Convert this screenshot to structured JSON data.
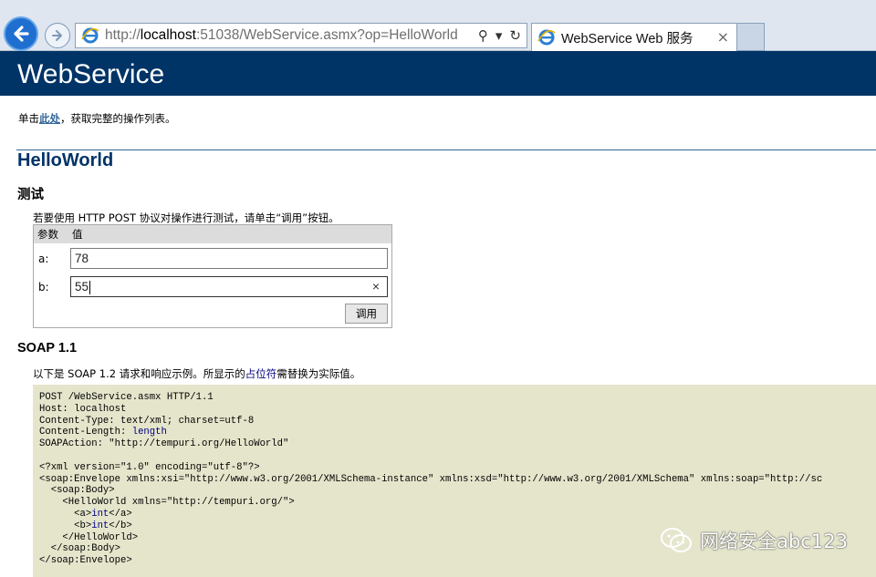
{
  "browser": {
    "url_prefix": "http://",
    "url_host": "localhost",
    "url_rest": ":51038/WebService.asmx?op=HelloWorld",
    "search_glyph": "⚲",
    "dropdown_glyph": "▾",
    "refresh_glyph": "↻",
    "tab_title": "WebService Web 服务",
    "tab_close": "×"
  },
  "header": {
    "title": "WebService"
  },
  "intro": {
    "before": "单击",
    "link": "此处",
    "after": "，获取完整的操作列表。"
  },
  "operation": {
    "name": "HelloWorld"
  },
  "test": {
    "heading": "测试",
    "note": "若要使用 HTTP POST 协议对操作进行测试，请单击“调用”按钮。",
    "col_param": "参数",
    "col_value": "值",
    "params": [
      {
        "label": "a:",
        "value": "78"
      },
      {
        "label": "b:",
        "value": "55"
      }
    ],
    "clear_glyph": "×",
    "invoke_label": "调用"
  },
  "soap": {
    "heading": "SOAP 1.1",
    "note_before": "以下是 SOAP 1.2 请求和响应示例。所显示的",
    "note_link": "占位符",
    "note_after": "需替换为实际值。",
    "lines": [
      "POST /WebService.asmx HTTP/1.1",
      "Host: localhost",
      "Content-Type: text/xml; charset=utf-8",
      "Content-Length: ",
      "SOAPAction: \"http://tempuri.org/HelloWorld\"",
      "",
      "<?xml version=\"1.0\" encoding=\"utf-8\"?>",
      "<soap:Envelope xmlns:xsi=\"http://www.w3.org/2001/XMLSchema-instance\" xmlns:xsd=\"http://www.w3.org/2001/XMLSchema\" xmlns:soap=\"http://sc",
      "  <soap:Body>",
      "    <HelloWorld xmlns=\"http://tempuri.org/\">",
      "      <a>",
      "      <b>",
      "    </HelloWorld>",
      "  </soap:Body>",
      "</soap:Envelope>"
    ],
    "placeholder_length": "length",
    "placeholder_int": "int",
    "close_a": "</a>",
    "close_b": "</b>"
  },
  "watermark": {
    "text": "网络安全abc123"
  },
  "colors": {
    "header_bg": "#003366",
    "link": "#336699",
    "code_bg": "#e5e5cc"
  }
}
